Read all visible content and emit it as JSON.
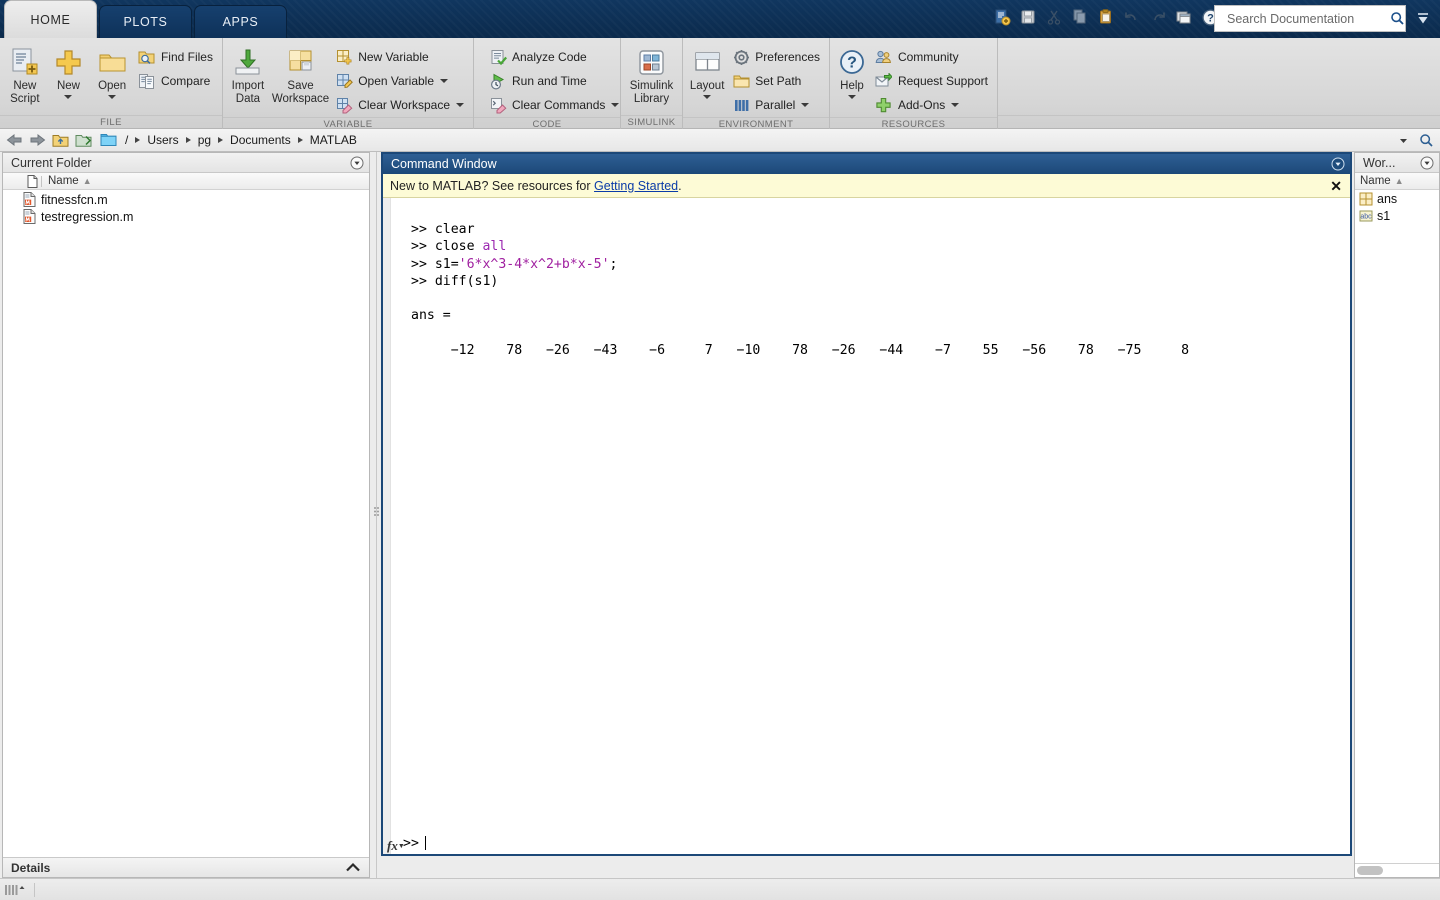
{
  "app": {
    "tabs": [
      {
        "label": "HOME",
        "active": true
      },
      {
        "label": "PLOTS",
        "active": false
      },
      {
        "label": "APPS",
        "active": false
      }
    ],
    "quick_access": [
      "new-script-icon",
      "save-icon",
      "cut-icon",
      "copy-icon",
      "paste-icon",
      "undo-icon",
      "redo-icon",
      "switch-window-icon",
      "help-icon"
    ],
    "search": {
      "placeholder": "Search Documentation",
      "value": "",
      "icon": "search-icon"
    },
    "minimize_ribbon_icon": "minimize-ribbon-icon"
  },
  "ribbon": {
    "groups": [
      {
        "label": "FILE",
        "big_buttons": [
          {
            "label_line1": "New",
            "label_line2": "Script",
            "icon": "new-script-icon",
            "has_caret": false
          },
          {
            "label_line1": "New",
            "label_line2": "",
            "icon": "new-plus-icon",
            "has_caret": true
          },
          {
            "label_line1": "Open",
            "label_line2": "",
            "icon": "open-folder-icon",
            "has_caret": true
          }
        ],
        "small_buttons": [
          {
            "label": "Find Files",
            "icon": "find-files-icon",
            "has_caret": false
          },
          {
            "label": "Compare",
            "icon": "compare-icon",
            "has_caret": false
          }
        ]
      },
      {
        "label": "VARIABLE",
        "big_buttons": [
          {
            "label_line1": "Import",
            "label_line2": "Data",
            "icon": "import-data-icon",
            "has_caret": false
          },
          {
            "label_line1": "Save",
            "label_line2": "Workspace",
            "icon": "save-workspace-icon",
            "has_caret": false
          }
        ],
        "small_buttons": [
          {
            "label": "New Variable",
            "icon": "new-variable-icon",
            "has_caret": false
          },
          {
            "label": "Open Variable",
            "icon": "open-variable-icon",
            "has_caret": true
          },
          {
            "label": "Clear Workspace",
            "icon": "clear-workspace-icon",
            "has_caret": true
          }
        ]
      },
      {
        "label": "CODE",
        "big_buttons": [],
        "small_buttons": [
          {
            "label": "Analyze Code",
            "icon": "analyze-code-icon",
            "has_caret": false
          },
          {
            "label": "Run and Time",
            "icon": "run-and-time-icon",
            "has_caret": false
          },
          {
            "label": "Clear Commands",
            "icon": "clear-commands-icon",
            "has_caret": true
          }
        ]
      },
      {
        "label": "SIMULINK",
        "big_buttons": [
          {
            "label_line1": "Simulink",
            "label_line2": "Library",
            "icon": "simulink-library-icon",
            "has_caret": false
          }
        ],
        "small_buttons": []
      },
      {
        "label": "ENVIRONMENT",
        "big_buttons": [
          {
            "label_line1": "Layout",
            "label_line2": "",
            "icon": "layout-icon",
            "has_caret": true
          }
        ],
        "small_buttons": [
          {
            "label": "Preferences",
            "icon": "preferences-gear-icon",
            "has_caret": false
          },
          {
            "label": "Set Path",
            "icon": "set-path-icon",
            "has_caret": false
          },
          {
            "label": "Parallel",
            "icon": "parallel-icon",
            "has_caret": true
          }
        ]
      },
      {
        "label": "RESOURCES",
        "big_buttons": [
          {
            "label_line1": "Help",
            "label_line2": "",
            "icon": "help-question-icon",
            "has_caret": true
          }
        ],
        "small_buttons": [
          {
            "label": "Community",
            "icon": "community-icon",
            "has_caret": false
          },
          {
            "label": "Request Support",
            "icon": "request-support-icon",
            "has_caret": false
          },
          {
            "label": "Add-Ons",
            "icon": "add-ons-icon",
            "has_caret": true
          }
        ]
      }
    ]
  },
  "addressbar": {
    "back_icon": "back-arrow-icon",
    "forward_icon": "forward-arrow-icon",
    "up_icon": "go-up-folder-icon",
    "browse_icon": "browse-folder-icon",
    "folder_icon": "folder-icon",
    "crumbs": [
      "/",
      "Users",
      "pg",
      "Documents",
      "MATLAB"
    ],
    "dropdown_icon": "chevron-down-icon",
    "refresh_icon": "search-path-icon"
  },
  "current_folder": {
    "title": "Current Folder",
    "collapse_icon": "panel-menu-icon",
    "column_header": "Name",
    "sort_indicator": "▲",
    "files": [
      {
        "name": "fitnessfcn.m",
        "icon": "m-file-icon"
      },
      {
        "name": "testregression.m",
        "icon": "m-file-icon"
      }
    ],
    "details_label": "Details",
    "details_chevron": "chevron-up-icon"
  },
  "command_window": {
    "title": "Command Window",
    "collapse_icon": "panel-menu-icon",
    "banner": {
      "text_before": "New to MATLAB? See resources for ",
      "link": "Getting Started",
      "text_after": ".",
      "close_icon": "close-icon"
    },
    "lines": [
      {
        "type": "command",
        "prompt": ">> ",
        "text": "clear"
      },
      {
        "type": "command",
        "prompt": ">> ",
        "text": "close ",
        "keyword": "all"
      },
      {
        "type": "command",
        "prompt": ">> ",
        "text": "s1=",
        "string": "'6*x^3-4*x^2+b*x-5'",
        "suffix": ";"
      },
      {
        "type": "command",
        "prompt": ">> ",
        "text": "diff(s1)"
      },
      {
        "type": "blank",
        "text": ""
      },
      {
        "type": "output",
        "text": "ans ="
      },
      {
        "type": "blank",
        "text": ""
      },
      {
        "type": "result_row",
        "values": [
          -12,
          78,
          -26,
          -43,
          -6,
          7,
          -10,
          78,
          -26,
          -44,
          -7,
          55,
          -56,
          78,
          -75,
          8
        ]
      }
    ],
    "prompt": ">>",
    "fx_label": "fx",
    "fx_icon": "function-browser-icon"
  },
  "workspace": {
    "title": "Wor...",
    "collapse_icon": "panel-menu-icon",
    "column_header": "Name",
    "sort_indicator": "▲",
    "variables": [
      {
        "name": "ans",
        "icon": "matrix-variable-icon"
      },
      {
        "name": "s1",
        "icon": "string-variable-icon"
      }
    ]
  },
  "statusbar": {
    "grip_icon": "resize-grip-icon"
  },
  "colors": {
    "tab_active_bg": "#e4e4e4",
    "tab_inactive_bg": "#123a66",
    "titlebar_navy": "#1c4878",
    "banner_yellow": "#fdfbd6",
    "link_blue": "#0a3ba8",
    "string_magenta": "#a020a0",
    "keyword_purple": "#9b27b0",
    "ribbon_bg": "#d8d8d8"
  }
}
